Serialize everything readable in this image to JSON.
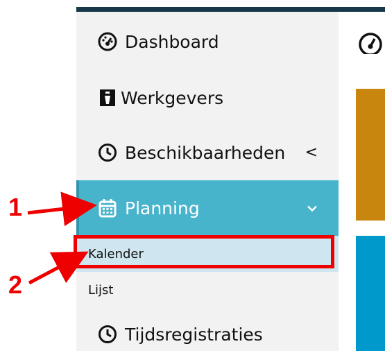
{
  "sidebar": {
    "items": [
      {
        "label": "Dashboard",
        "icon": "gauge-icon"
      },
      {
        "label": "Werkgevers",
        "icon": "id-card-icon"
      },
      {
        "label": "Beschikbaarheden",
        "icon": "clock-icon",
        "chevron": "<"
      },
      {
        "label": "Planning",
        "icon": "calendar-icon",
        "chevron": "chevron-down"
      },
      {
        "label": "Tijdsregistraties",
        "icon": "clock-icon"
      }
    ],
    "submenu": [
      {
        "label": "Kalender"
      },
      {
        "label": "Lijst"
      }
    ]
  },
  "annotations": {
    "step1": "1",
    "step2": "2"
  },
  "colors": {
    "accent": "#47b4cc",
    "highlight": "#ee0000",
    "orange_card": "#c8860e",
    "blue_card": "#0099cc",
    "top_bar": "#173848"
  }
}
